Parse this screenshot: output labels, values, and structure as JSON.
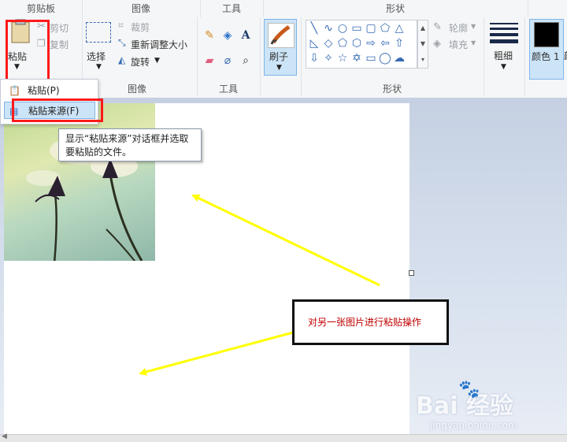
{
  "ribbon": {
    "groups": {
      "clipboard": "剪贴板",
      "image": "图像",
      "tools": "工具",
      "shapes": "形状"
    },
    "footers": {
      "image": "图像",
      "tools": "工具",
      "shapes": "形状"
    },
    "clipboard": {
      "paste": "粘贴",
      "cut": "剪切",
      "copy": "复制"
    },
    "image": {
      "select": "选择",
      "crop": "裁剪",
      "resize": "重新调整大小",
      "rotate": "旋转"
    },
    "brushes": "刷子",
    "outline": "轮廓",
    "fill": "填充",
    "size": "粗细",
    "color1": "颜色 1",
    "color2": "颜"
  },
  "paste_menu": {
    "items": [
      {
        "label": "粘贴(P)"
      },
      {
        "label": "粘贴来源(F)"
      }
    ]
  },
  "tooltip": {
    "line1": "显示“粘贴来源”对话框并选取",
    "line2": "要粘贴的文件。"
  },
  "annotation": {
    "text": "对另一张图片进行粘贴操作"
  },
  "watermark": {
    "brand": "Bai 经验",
    "url": "jingyan.baidu.com"
  },
  "colors": {
    "arrow": "#ffff00",
    "highlight": "#ff1a1a",
    "annotation_text": "#c00000",
    "color1_swatch": "#000000",
    "selected_bg": "#cce4f7"
  },
  "icons": [
    "clipboard-icon",
    "scissors-icon",
    "copy-icon",
    "select-icon",
    "crop-icon",
    "resize-icon",
    "rotate-icon",
    "pencil-icon",
    "fill-icon",
    "text-icon",
    "eraser-icon",
    "color-picker-icon",
    "magnifier-icon",
    "brush-icon",
    "outline-icon",
    "fill-shape-icon",
    "size-icon"
  ]
}
